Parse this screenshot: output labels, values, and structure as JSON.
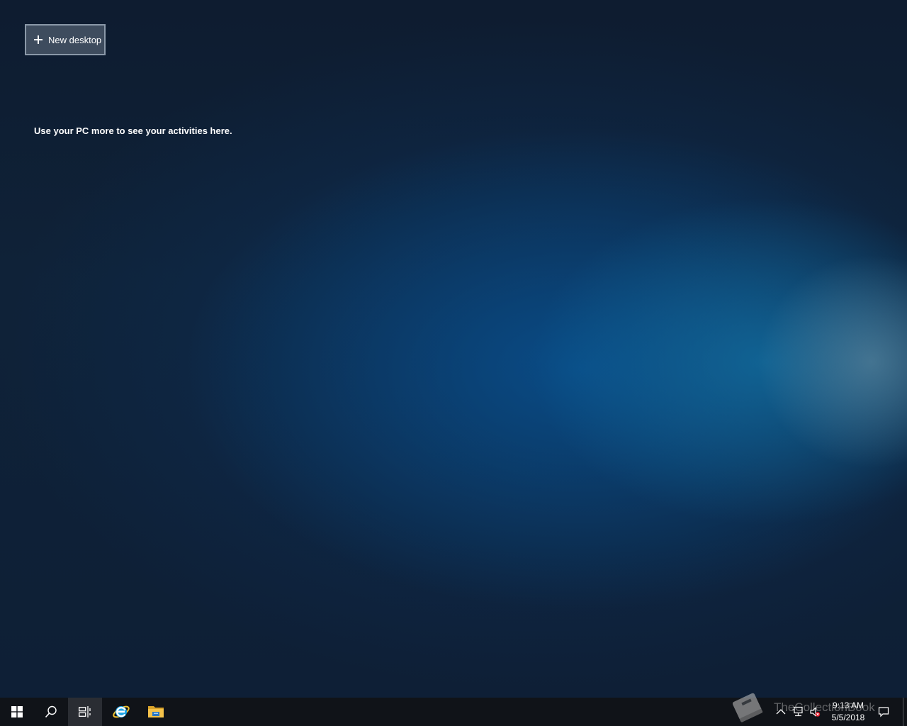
{
  "desktop": {
    "new_desktop_label": "New desktop",
    "activities_message": "Use your PC more to see your activities here.",
    "button_bg": "#465566",
    "button_border": "#8a98a8"
  },
  "taskbar": {
    "start_icon": "windows-start-icon",
    "search_icon": "search-icon",
    "task_view_icon": "task-view-icon",
    "pinned_apps": [
      {
        "name": "Internet Explorer",
        "icon": "internet-explorer-icon",
        "color": "#1ea5e6"
      },
      {
        "name": "File Explorer",
        "icon": "file-explorer-icon",
        "color": "#f4c24a"
      }
    ],
    "tray_icons": [
      "chevron-up-icon",
      "network-icon",
      "volume-muted-icon",
      "action-center-icon"
    ],
    "clock_time": "9:13 AM",
    "clock_date": "5/5/2018",
    "background": "#101318"
  },
  "watermark": {
    "text": "TheCollectionBook",
    "icon": "book-icon"
  }
}
